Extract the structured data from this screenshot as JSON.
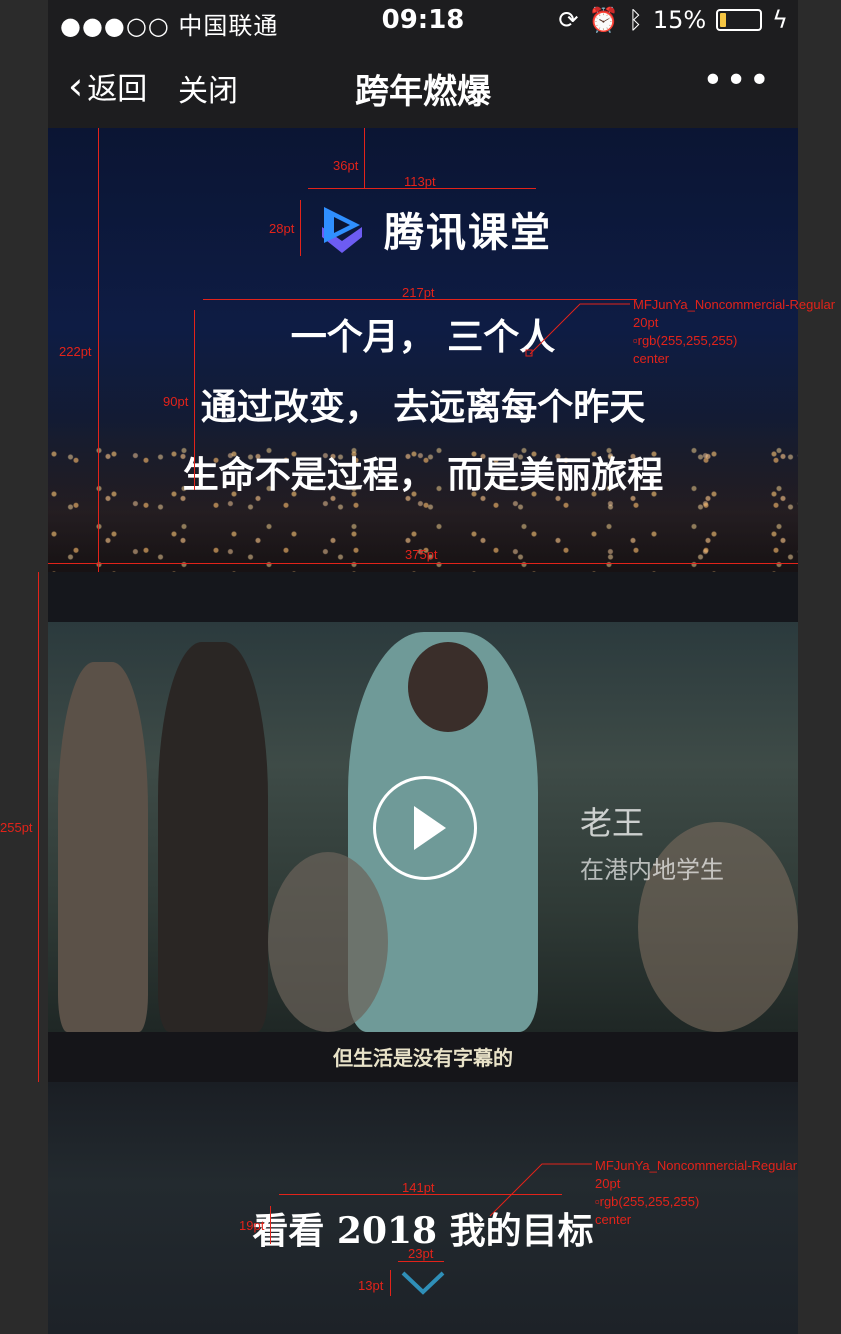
{
  "status": {
    "carrier": "●●●○○ 中国联通",
    "time": "09:18",
    "battery": "15%",
    "battery_level": 0.15
  },
  "nav": {
    "back": "返回",
    "close": "关闭",
    "title": "跨年燃爆",
    "more": "•••"
  },
  "hero": {
    "logo_text": "腾讯课堂",
    "lines": [
      "一个月， 三个人",
      "通过改变， 去远离每个昨天",
      "生命不是过程， 而是美丽旅程"
    ]
  },
  "video": {
    "name": "老王",
    "role": "在港内地学生",
    "caption": "但生活是没有字幕的"
  },
  "bottom": {
    "goal": "看看 2018 我的目标"
  },
  "annotations": {
    "a36": "36pt",
    "a113": "113pt",
    "a28": "28pt",
    "a217": "217pt",
    "a222": "222pt",
    "a90": "90pt",
    "a375": "375pt",
    "a255": "255pt",
    "a141": "141pt",
    "a19": "19pt",
    "a23": "23pt",
    "a13": "13pt",
    "font1": "MFJunYa_Noncommercial-Regular",
    "size1": "20pt",
    "color1": "rgb(255,255,255)",
    "align1": "center",
    "font2": "MFJunYa_Noncommercial-Regular",
    "size2": "20pt",
    "color2": "rgb(255,255,255)",
    "align2": "center"
  },
  "colors": {
    "annotation": "#e2231a",
    "logo_blue": "#2f8fff",
    "logo_purple": "#6d5cf2"
  }
}
